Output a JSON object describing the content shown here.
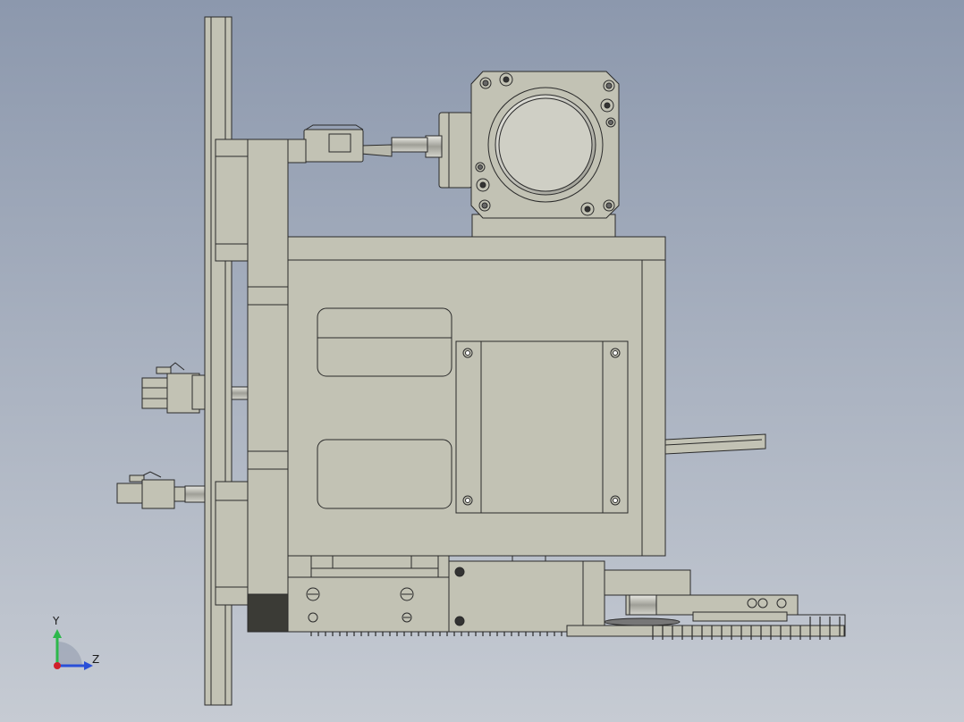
{
  "viewport": {
    "background_top": "#8c98ad",
    "background_bottom": "#c6cbd3",
    "part_fill": "#c2c2b4",
    "part_edge": "#2a2a2a"
  },
  "triad": {
    "y_label": "Y",
    "z_label": "Z",
    "x_axis_color": "#d0202a",
    "y_axis_color": "#2db84b",
    "z_axis_color": "#2a4fd8"
  }
}
